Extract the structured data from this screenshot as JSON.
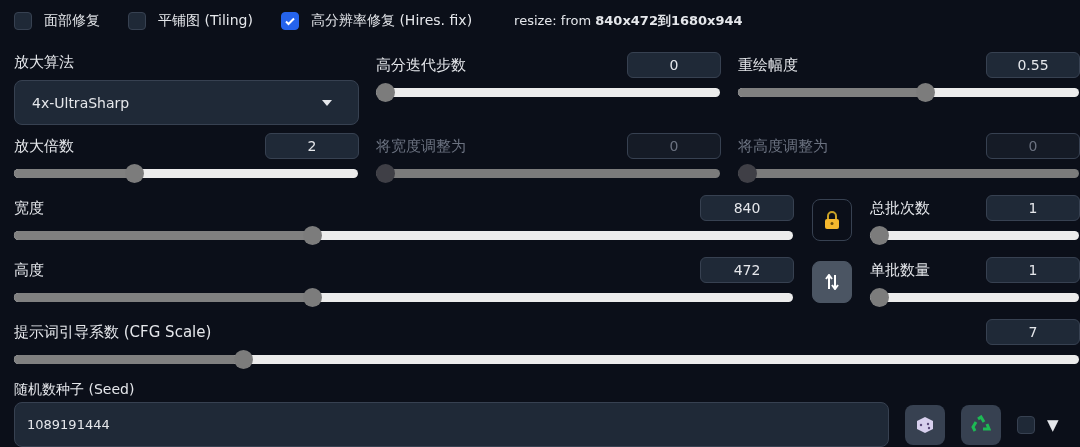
{
  "options": [
    {
      "label": "面部修复",
      "checked": false
    },
    {
      "label": "平铺图 (Tiling)",
      "checked": false
    },
    {
      "label": "高分辨率修复 (Hires. fix)",
      "checked": true
    }
  ],
  "resize_info": "resize: from **840x472到1680x944**",
  "upscaler": {
    "label": "放大算法",
    "value": "4x-UltraSharp"
  },
  "hires_fields": [
    {
      "label": "高分迭代步数",
      "value": "0",
      "level": 0,
      "disabled": false
    },
    {
      "label": "重绘幅度",
      "value": "0.55",
      "level": 0.55,
      "disabled": false
    },
    {
      "label": "放大倍数",
      "value": "2",
      "level": 0.34,
      "disabled": false
    },
    {
      "label": "将宽度调整为",
      "value": "0",
      "level": 0,
      "disabled": true
    },
    {
      "label": "将高度调整为",
      "value": "0",
      "level": 0,
      "disabled": true
    }
  ],
  "size_fields": [
    {
      "label": "宽度",
      "value": "840",
      "level": 0.38
    },
    {
      "label": "高度",
      "value": "472",
      "level": 0.38
    }
  ],
  "batch_fields": [
    {
      "label": "总批次数",
      "value": "1",
      "level": 0
    },
    {
      "label": "单批数量",
      "value": "1",
      "level": 0
    }
  ],
  "cfg": {
    "label": "提示词引导系数 (CFG Scale)",
    "value": "7",
    "level": 0.21
  },
  "seed": {
    "label": "随机数种子 (Seed)",
    "value": "1089191444",
    "extra_checked": false,
    "menu_glyph": "▼"
  }
}
